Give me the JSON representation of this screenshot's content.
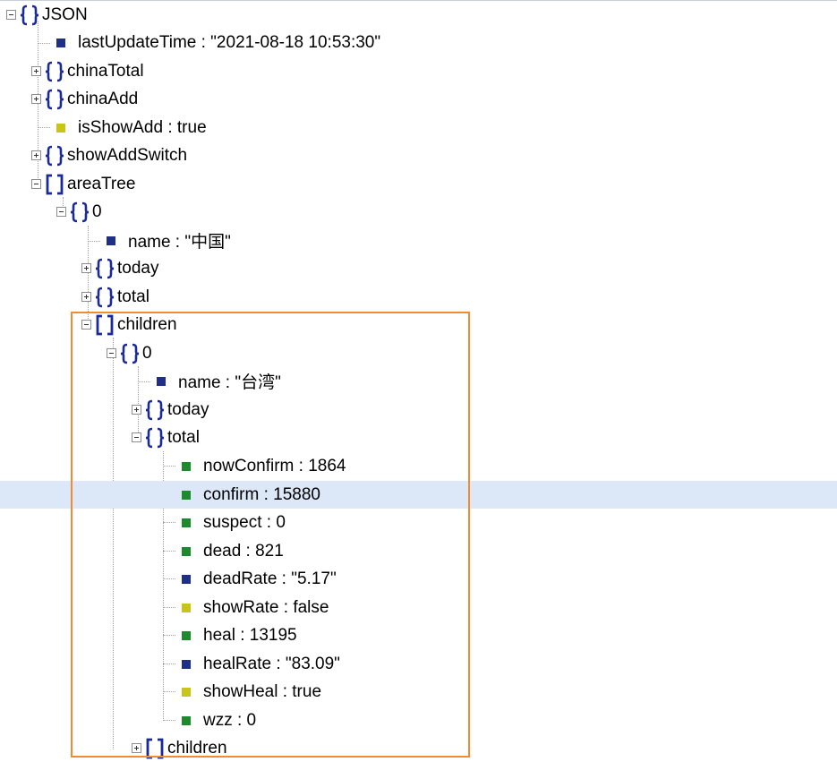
{
  "tree": {
    "root": "JSON",
    "lastUpdateTime": "lastUpdateTime : \"2021-08-18 10:53:30\"",
    "chinaTotal": "chinaTotal",
    "chinaAdd": "chinaAdd",
    "isShowAdd": "isShowAdd : true",
    "showAddSwitch": "showAddSwitch",
    "areaTree": "areaTree",
    "area0": "0",
    "area0_name": "name : \"中国\"",
    "area0_today": "today",
    "area0_total": "total",
    "area0_children": "children",
    "child0": "0",
    "child0_name": "name : \"台湾\"",
    "child0_today": "today",
    "child0_total": "total",
    "total_items": [
      {
        "label": "nowConfirm : 1864",
        "type": "num"
      },
      {
        "label": "confirm : 15880",
        "type": "num"
      },
      {
        "label": "suspect : 0",
        "type": "num"
      },
      {
        "label": "dead : 821",
        "type": "num"
      },
      {
        "label": "deadRate : \"5.17\"",
        "type": "str"
      },
      {
        "label": "showRate : false",
        "type": "bool"
      },
      {
        "label": "heal : 13195",
        "type": "num"
      },
      {
        "label": "healRate : \"83.09\"",
        "type": "str"
      },
      {
        "label": "showHeal : true",
        "type": "bool"
      },
      {
        "label": "wzz : 0",
        "type": "num"
      }
    ],
    "child0_children": "children"
  },
  "colors": {
    "string": "#1f2f88",
    "number": "#1d8a2e",
    "boolean": "#c8c418",
    "bracket": "#1a2a9a",
    "selection": "#dce8f7",
    "highlight_border": "#f28a30"
  },
  "icons": {
    "object": "curly-braces-icon",
    "array": "square-brackets-icon",
    "expand": "plus-box-icon",
    "collapse": "minus-box-icon"
  }
}
